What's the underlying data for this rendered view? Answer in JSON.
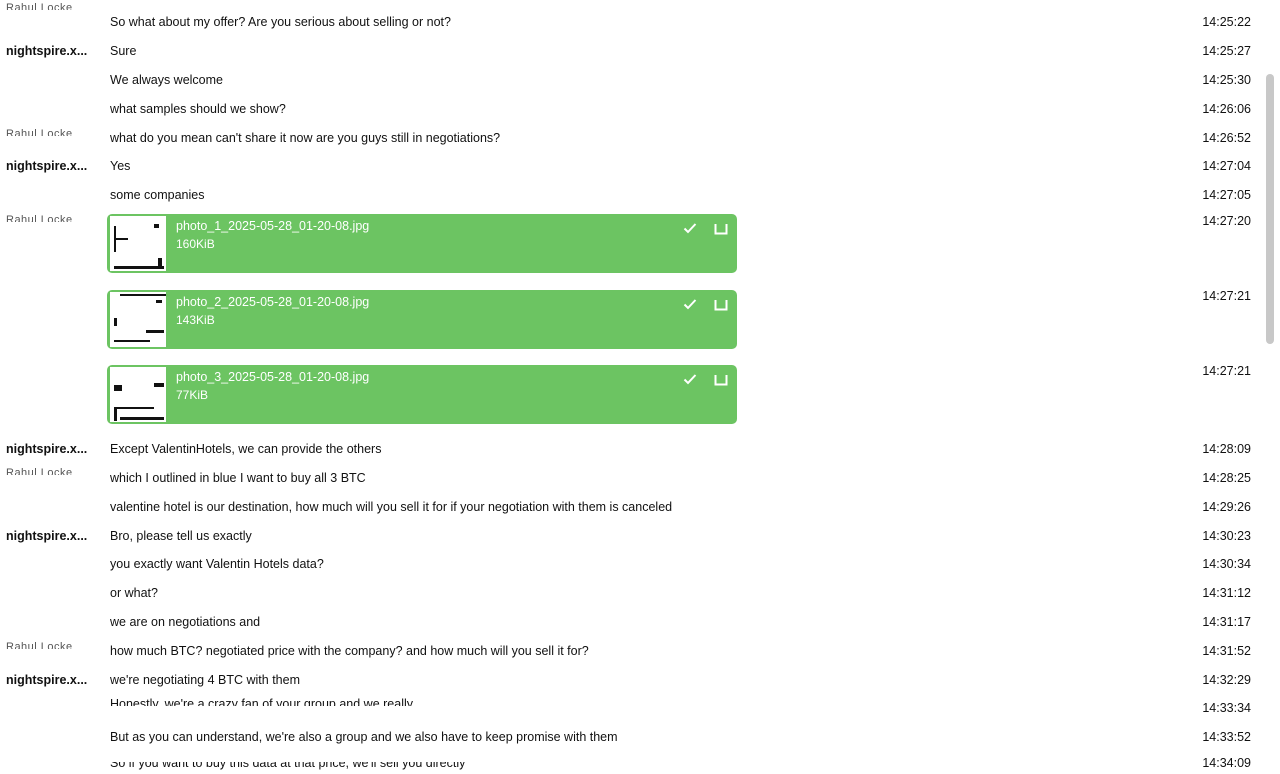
{
  "messages": [
    {
      "sender": "Rahul Locke",
      "text": "So what about my offer? Are you serious about selling or not?",
      "time": "14:25:22"
    },
    {
      "sender": "nightspire.x...",
      "text": "Sure",
      "time": "14:25:27"
    },
    {
      "sender": "",
      "text": "We always welcome",
      "time": "14:25:30"
    },
    {
      "sender": "",
      "text": "what samples should we show?",
      "time": "14:26:06"
    },
    {
      "sender": "Rahul Locke",
      "text": "what do you mean can't share it now are you guys still in negotiations?",
      "time": "14:26:52"
    },
    {
      "sender": "nightspire.x...",
      "text": "Yes",
      "time": "14:27:04"
    },
    {
      "sender": "",
      "text": "some companies",
      "time": "14:27:05"
    },
    {
      "sender": "Rahul Locke",
      "text": "",
      "time": "14:27:20"
    },
    {
      "sender": "",
      "text": "",
      "time": "14:27:21"
    },
    {
      "sender": "",
      "text": "",
      "time": "14:27:21"
    },
    {
      "sender": "nightspire.x...",
      "text": "Except ValentinHotels, we can provide the others",
      "time": "14:28:09"
    },
    {
      "sender": "Rahul Locke",
      "text": "which I outlined in blue I want to buy all 3 BTC",
      "time": "14:28:25"
    },
    {
      "sender": "",
      "text": "valentine hotel is our destination, how much will you sell it for if your negotiation with them is canceled",
      "time": "14:29:26"
    },
    {
      "sender": "nightspire.x...",
      "text": "Bro, please tell us exactly",
      "time": "14:30:23"
    },
    {
      "sender": "",
      "text": "you exactly want Valentin Hotels data?",
      "time": "14:30:34"
    },
    {
      "sender": "",
      "text": "or what?",
      "time": "14:31:12"
    },
    {
      "sender": "",
      "text": "we are on negotiations and",
      "time": "14:31:17"
    },
    {
      "sender": "Rahul Locke",
      "text": "how much BTC? negotiated price with the company? and how much will you sell it for?",
      "time": "14:31:52"
    },
    {
      "sender": "nightspire.x...",
      "text": "we're negotiating 4 BTC with them",
      "time": "14:32:29"
    },
    {
      "sender": "",
      "text": "Honestly, we're a crazy fan of your group and we really",
      "time": "14:33:34"
    },
    {
      "sender": "",
      "text": "But as you can understand, we're also a group and we also have to keep promise with them",
      "time": "14:33:52"
    },
    {
      "sender": "",
      "text": "So if you want to buy this data at that price, we'll sell you directly",
      "time": "14:34:09"
    }
  ],
  "files": [
    {
      "name": "photo_1_2025-05-28_01-20-08.jpg",
      "size": "160KiB"
    },
    {
      "name": "photo_2_2025-05-28_01-20-08.jpg",
      "size": "143KiB"
    },
    {
      "name": "photo_3_2025-05-28_01-20-08.jpg",
      "size": "77KiB"
    }
  ],
  "colors": {
    "file_bubble": "#6cc462",
    "text": "#111111",
    "scrollbar": "#c8c8c8"
  },
  "icons": {
    "sent": "check-icon",
    "download": "download-icon"
  }
}
